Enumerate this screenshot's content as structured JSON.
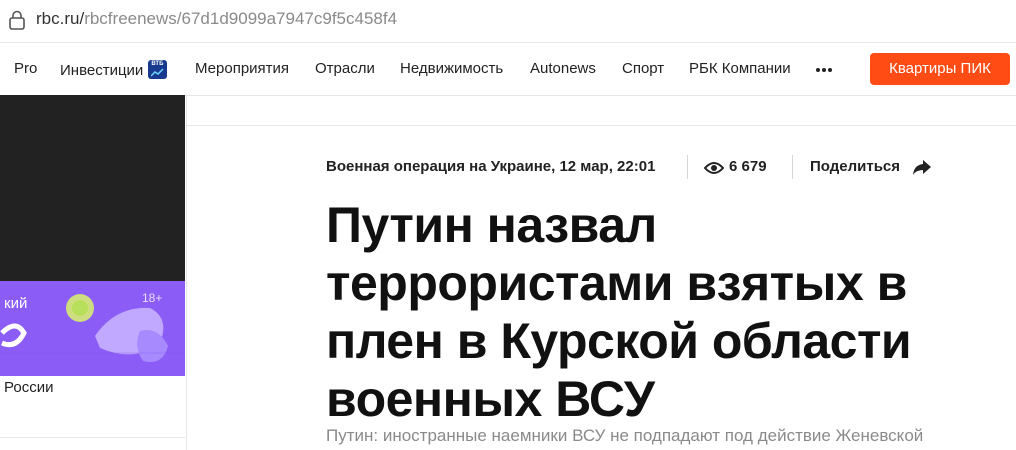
{
  "browser": {
    "url_domain": "rbc.ru/",
    "url_path": "rbcfreenews/67d1d9099a7947c9f5c458f4"
  },
  "nav": {
    "items": [
      "Pro",
      "Инвестиции",
      "Мероприятия",
      "Отрасли",
      "Недвижимость",
      "Autonews",
      "Спорт",
      "РБК Компании"
    ],
    "vtb_badge": "ВТБ",
    "more_icon": "more-dots-icon",
    "cta_label": "Квартиры ПИК",
    "cta_color": "#ff4b14"
  },
  "sidebar": {
    "promo_text": "кий",
    "promo_age": "18+",
    "caption": "России"
  },
  "article": {
    "category_date": "Военная операция на Украине, 12 мар, 22:01",
    "views": "6 679",
    "share_label": "Поделиться",
    "headline": "Путин назвал террористами взятых в плен в Курской области военных ВСУ",
    "lead": "Путин: иностранные наемники ВСУ не подпадают под действие Женевской"
  }
}
